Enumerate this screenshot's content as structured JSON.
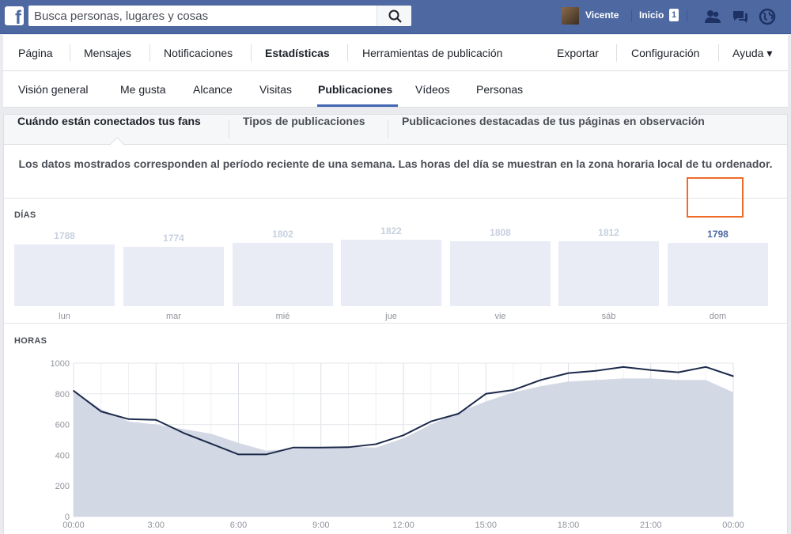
{
  "topbar": {
    "search_placeholder": "Busca personas, lugares y cosas",
    "user_name": "Vicente",
    "home_label": "Inicio",
    "home_count": "1"
  },
  "page_nav": {
    "items": [
      "Página",
      "Mensajes",
      "Notificaciones",
      "Estadísticas",
      "Herramientas de publicación",
      "Exportar",
      "Configuración",
      "Ayuda ▾"
    ],
    "active": "Estadísticas"
  },
  "sub_nav": {
    "items": [
      "Visión general",
      "Me gusta",
      "Alcance",
      "Visitas",
      "Publicaciones",
      "Vídeos",
      "Personas"
    ],
    "active": "Publicaciones"
  },
  "tabs": {
    "items": [
      "Cuándo están conectados tus fans",
      "Tipos de publicaciones",
      "Publicaciones destacadas de tus páginas en observación"
    ]
  },
  "notice": "Los datos mostrados corresponden al período reciente de una semana. Las horas del día se muestran en la zona horaria local de tu ordenador.",
  "days_section": {
    "label": "DÍAS",
    "selected": "dom",
    "days": [
      {
        "label": "lun",
        "value": "1788"
      },
      {
        "label": "mar",
        "value": "1774"
      },
      {
        "label": "mié",
        "value": "1802"
      },
      {
        "label": "jue",
        "value": "1822"
      },
      {
        "label": "vie",
        "value": "1808"
      },
      {
        "label": "sáb",
        "value": "1812"
      },
      {
        "label": "dom",
        "value": "1798"
      }
    ]
  },
  "hours_section": {
    "label": "HORAS"
  },
  "colors": {
    "brand": "#4e69a2",
    "line": "#1c2a4a",
    "area": "#d3d8e5",
    "highlight": "#ef6b27"
  },
  "chart_data": {
    "type": "line",
    "x": [
      0,
      1,
      2,
      3,
      4,
      5,
      6,
      7,
      8,
      9,
      10,
      11,
      12,
      13,
      14,
      15,
      16,
      17,
      18,
      19,
      20,
      21,
      22,
      23,
      24
    ],
    "xticks": [
      "00:00",
      "3:00",
      "6:00",
      "9:00",
      "12:00",
      "15:00",
      "18:00",
      "21:00",
      "00:00"
    ],
    "xtick_positions": [
      0,
      3,
      6,
      9,
      12,
      15,
      18,
      21,
      24
    ],
    "ylim": [
      0,
      1000
    ],
    "yticks": [
      0,
      200,
      400,
      600,
      800,
      1000
    ],
    "series": [
      {
        "kind": "area",
        "values": [
          820,
          700,
          620,
          600,
          570,
          540,
          480,
          430,
          440,
          450,
          455,
          450,
          510,
          600,
          680,
          750,
          810,
          850,
          880,
          890,
          900,
          900,
          890,
          890,
          810
        ]
      },
      {
        "kind": "line",
        "values": [
          820,
          685,
          635,
          630,
          545,
          475,
          405,
          405,
          450,
          450,
          452,
          472,
          530,
          620,
          670,
          800,
          825,
          890,
          935,
          950,
          975,
          955,
          940,
          975,
          915
        ]
      }
    ]
  }
}
